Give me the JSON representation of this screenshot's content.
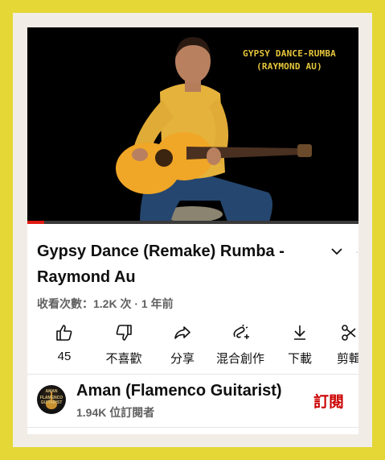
{
  "video": {
    "caption_line1": "GYPSY DANCE-RUMBA",
    "caption_line2": "(RAYMOND AU)",
    "progress": 0.05
  },
  "title": "Gypsy Dance (Remake)  Rumba - Raymond Au",
  "meta": "收看次數：1.2K 次 · 1 年前",
  "actions": {
    "like": "45",
    "dislike": "不喜歡",
    "share": "分享",
    "remix": "混合創作",
    "download": "下載",
    "clip": "剪輯"
  },
  "channel": {
    "name": "Aman (Flamenco Guitarist)",
    "subscribers": "1.94K 位訂閱者",
    "subscribe_label": "訂閱",
    "avatar_text_line1": "AMAN",
    "avatar_text_line2": "FLAMENCO",
    "avatar_text_line3": "GUITARIST"
  },
  "colors": {
    "page_border": "#e4d736",
    "subscribe": "#cc0000",
    "progress": "#e01a12",
    "caption": "#e6c63b"
  }
}
